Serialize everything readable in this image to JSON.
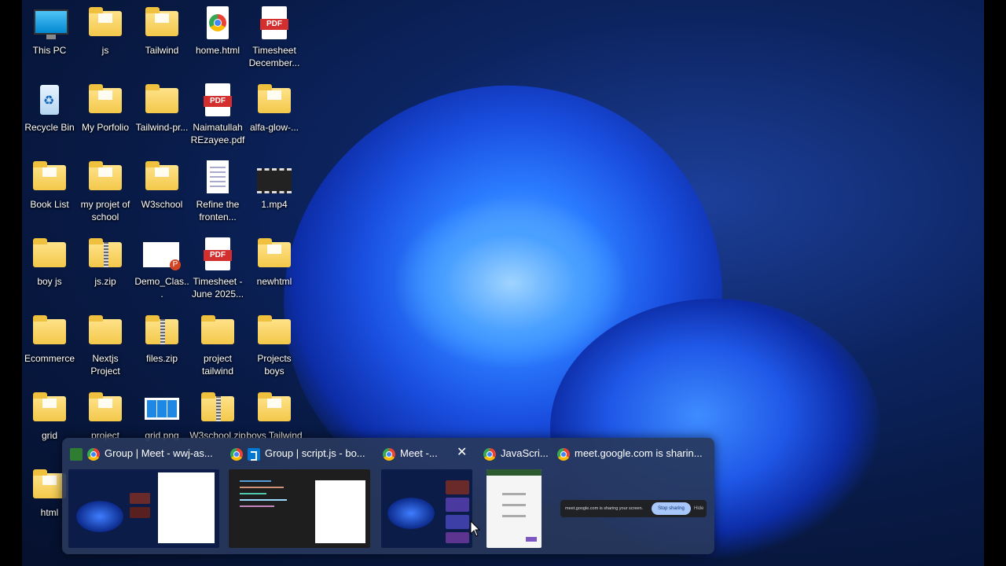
{
  "desktop": {
    "icons": [
      {
        "label": "This PC",
        "type": "pc-icon"
      },
      {
        "label": "js",
        "type": "folder-icon"
      },
      {
        "label": "Tailwind",
        "type": "folder-icon"
      },
      {
        "label": "home.html",
        "type": "chrome-file-icon"
      },
      {
        "label": "Timesheet December...",
        "type": "pdf-icon"
      },
      {
        "label": "Recycle Bin",
        "type": "recycle-bin-icon"
      },
      {
        "label": "My Porfolio",
        "type": "folder-icon"
      },
      {
        "label": "Tailwind-pr...",
        "type": "folder-icon"
      },
      {
        "label": "Naimatullah REzayee.pdf",
        "type": "pdf-icon"
      },
      {
        "label": "alfa-glow-...",
        "type": "folder-icon"
      },
      {
        "label": "Book List",
        "type": "folder-icon"
      },
      {
        "label": "my projet of school",
        "type": "folder-icon"
      },
      {
        "label": "W3school",
        "type": "folder-icon"
      },
      {
        "label": "Refine the fronten...",
        "type": "document-icon"
      },
      {
        "label": "1.mp4",
        "type": "video-icon"
      },
      {
        "label": "boy js",
        "type": "folder-icon"
      },
      {
        "label": "js.zip",
        "type": "zip-folder-icon"
      },
      {
        "label": "Demo_Clas...",
        "type": "powerpoint-icon"
      },
      {
        "label": "Timesheet - June 2025...",
        "type": "pdf-icon"
      },
      {
        "label": "newhtml",
        "type": "folder-icon"
      },
      {
        "label": "Ecommerce",
        "type": "folder-icon"
      },
      {
        "label": "Nextjs Project",
        "type": "folder-icon"
      },
      {
        "label": "files.zip",
        "type": "zip-folder-icon"
      },
      {
        "label": "project tailwind",
        "type": "folder-icon"
      },
      {
        "label": "Projects boys",
        "type": "folder-icon"
      },
      {
        "label": "grid",
        "type": "folder-icon"
      },
      {
        "label": "project",
        "type": "folder-icon"
      },
      {
        "label": "grid.png",
        "type": "image-icon"
      },
      {
        "label": "W3school.zip",
        "type": "zip-folder-icon"
      },
      {
        "label": "boys Tailwind",
        "type": "folder-icon"
      },
      {
        "label": "html",
        "type": "folder-icon"
      }
    ]
  },
  "switcher": {
    "windows": [
      {
        "title": "Group | Meet - wwj-as...",
        "app": "chrome-icon",
        "extra_icon": "sheets-icon"
      },
      {
        "title": "Group | script.js - bo...",
        "app": "vscode-icon"
      },
      {
        "title": "Meet -...",
        "app": "chrome-icon",
        "close": "✕"
      },
      {
        "title": "JavaScri...",
        "app": "chrome-icon"
      },
      {
        "title": "meet.google.com is sharin...",
        "app": "chrome-icon"
      }
    ],
    "share_bar": {
      "text": "meet.google.com is sharing your screen.",
      "stop_label": "Stop sharing",
      "hide_label": "Hide"
    }
  }
}
